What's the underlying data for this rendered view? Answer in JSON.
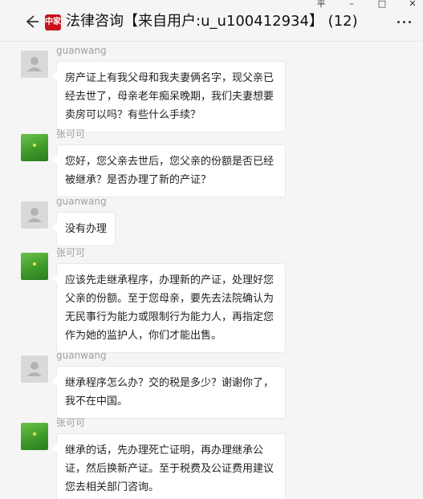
{
  "window": {
    "controls": [
      "平",
      "–",
      "□",
      "✕"
    ]
  },
  "header": {
    "app_logo_text": "中家",
    "title": "法律咨询【来自用户:u_u100412934】 (12)"
  },
  "messages": [
    {
      "sender": "guanwang",
      "avatar": "grey",
      "text": "房产证上有我父母和我夫妻俩名字，现父亲已经去世了，母亲老年痴呆晚期，我们夫妻想要卖房可以吗？有些什么手续？"
    },
    {
      "sender": "张可可",
      "avatar": "green",
      "text": "您好，您父亲去世后，您父亲的份额是否已经被继承？是否办理了新的产证？"
    },
    {
      "sender": "guanwang",
      "avatar": "grey",
      "text": "没有办理"
    },
    {
      "sender": "张可可",
      "avatar": "green",
      "text": "应该先走继承程序，办理新的产证，处理好您父亲的份额。至于您母亲，要先去法院确认为无民事行为能力或限制行为能力人，再指定您作为她的监护人，你们才能出售。"
    },
    {
      "sender": "guanwang",
      "avatar": "grey",
      "text": "继承程序怎么办？交的税是多少？谢谢你了，我不在中国。"
    },
    {
      "sender": "张可可",
      "avatar": "green",
      "text": "继承的话，先办理死亡证明，再办理继承公证，然后换新产证。至于税费及公证费用建议您去相关部门咨询。"
    }
  ]
}
